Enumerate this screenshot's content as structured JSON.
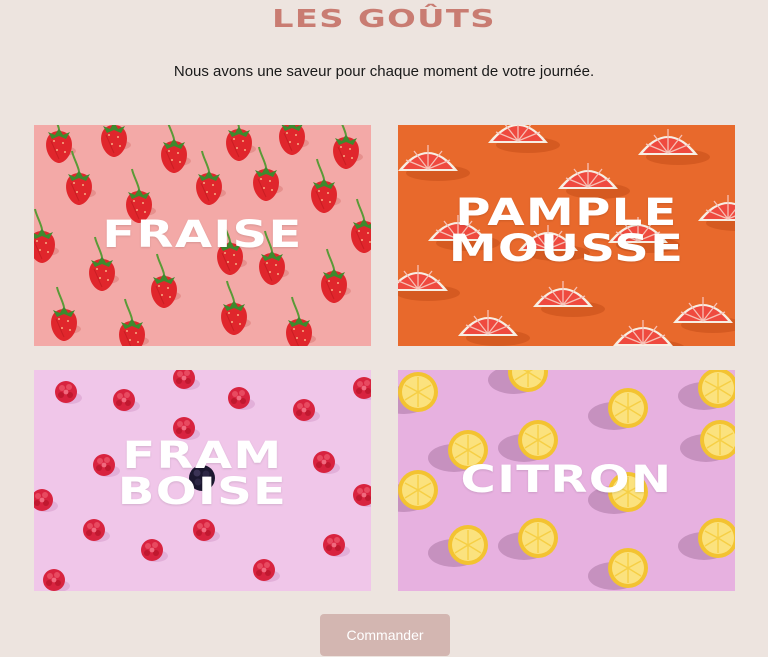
{
  "header": {
    "title": "LES GOÛTS",
    "subtitle": "Nous avons une saveur pour chaque moment de votre journée."
  },
  "flavors": [
    {
      "id": "fraise",
      "lines": [
        "FRAISE"
      ],
      "background_color": "#f3a9a7",
      "pattern": "strawberry"
    },
    {
      "id": "pamplemousse",
      "lines": [
        "PAMPLE",
        "MOUSSE"
      ],
      "background_color": "#e8692c",
      "pattern": "grapefruit"
    },
    {
      "id": "framboise",
      "lines": [
        "FRAM",
        "BOISE"
      ],
      "background_color": "#f0c6e9",
      "pattern": "raspberry"
    },
    {
      "id": "citron",
      "lines": [
        "CITRON"
      ],
      "background_color": "#e7b1e0",
      "pattern": "lemon"
    }
  ],
  "actions": {
    "order_label": "Commander"
  },
  "colors": {
    "page_background": "#ede4df",
    "title_color": "#c97c72",
    "button_background": "#d3b6b1"
  }
}
